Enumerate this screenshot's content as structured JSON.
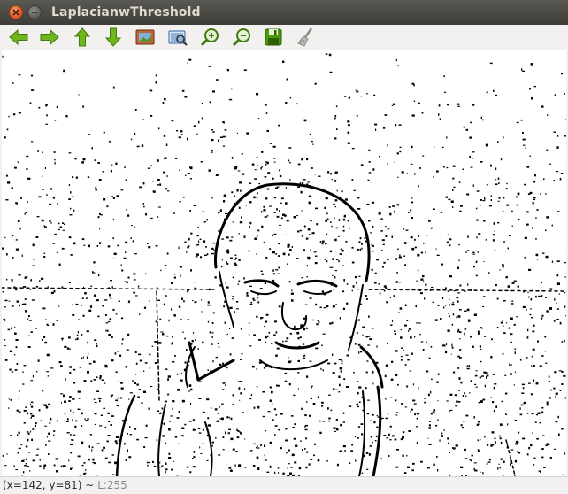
{
  "window": {
    "title": "LaplacianwThreshold",
    "close_icon": "close-icon",
    "minimize_icon": "minimize-icon"
  },
  "toolbar": {
    "items": [
      {
        "icon": "pan-left-icon",
        "color": "#4e9a06"
      },
      {
        "icon": "pan-right-icon",
        "color": "#4e9a06"
      },
      {
        "icon": "pan-up-icon",
        "color": "#4e9a06"
      },
      {
        "icon": "pan-down-icon",
        "color": "#4e9a06"
      },
      {
        "icon": "zoom-original-icon",
        "color": "#b5562c"
      },
      {
        "icon": "zoom-fit-icon",
        "color": "#3465a4"
      },
      {
        "icon": "zoom-in-icon",
        "color": "#4e9a06"
      },
      {
        "icon": "zoom-out-icon",
        "color": "#4e9a06"
      },
      {
        "icon": "save-icon",
        "color": "#4e9a06"
      },
      {
        "icon": "properties-icon",
        "color": "#888a85"
      }
    ]
  },
  "image": {
    "description_icon": "laplacian-edge-image"
  },
  "status": {
    "coords": "(x=142, y=81) ~",
    "value": "L:255"
  }
}
